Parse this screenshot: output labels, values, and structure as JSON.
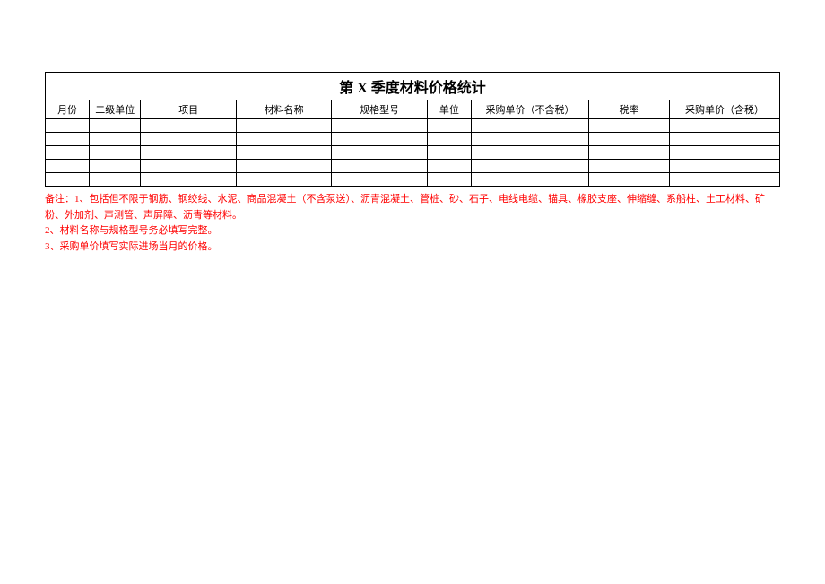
{
  "title": "第 X 季度材料价格统计",
  "headers": {
    "month": "月份",
    "secondUnit": "二级单位",
    "project": "项目",
    "materialName": "材料名称",
    "spec": "规格型号",
    "unit": "单位",
    "priceNoTax": "采购单价（不含税）",
    "taxRate": "税率",
    "priceWithTax": "采购单价（含税）"
  },
  "rows": [
    {
      "month": "",
      "secondUnit": "",
      "project": "",
      "materialName": "",
      "spec": "",
      "unit": "",
      "priceNoTax": "",
      "taxRate": "",
      "priceWithTax": ""
    },
    {
      "month": "",
      "secondUnit": "",
      "project": "",
      "materialName": "",
      "spec": "",
      "unit": "",
      "priceNoTax": "",
      "taxRate": "",
      "priceWithTax": ""
    },
    {
      "month": "",
      "secondUnit": "",
      "project": "",
      "materialName": "",
      "spec": "",
      "unit": "",
      "priceNoTax": "",
      "taxRate": "",
      "priceWithTax": ""
    },
    {
      "month": "",
      "secondUnit": "",
      "project": "",
      "materialName": "",
      "spec": "",
      "unit": "",
      "priceNoTax": "",
      "taxRate": "",
      "priceWithTax": ""
    },
    {
      "month": "",
      "secondUnit": "",
      "project": "",
      "materialName": "",
      "spec": "",
      "unit": "",
      "priceNoTax": "",
      "taxRate": "",
      "priceWithTax": ""
    }
  ],
  "notes": {
    "line1": "备注：1、包括但不限于钢筋、钢绞线、水泥、商品混凝土（不含泵送）、沥青混凝土、管桩、砂、石子、电线电缆、锚具、橡胶支座、伸缩缝、系船柱、土工材料、矿粉、外加剂、声测管、声屏障、沥青等材料。",
    "line2": "2、材料名称与规格型号务必填写完整。",
    "line3": "3、采购单价填写实际进场当月的价格。"
  }
}
